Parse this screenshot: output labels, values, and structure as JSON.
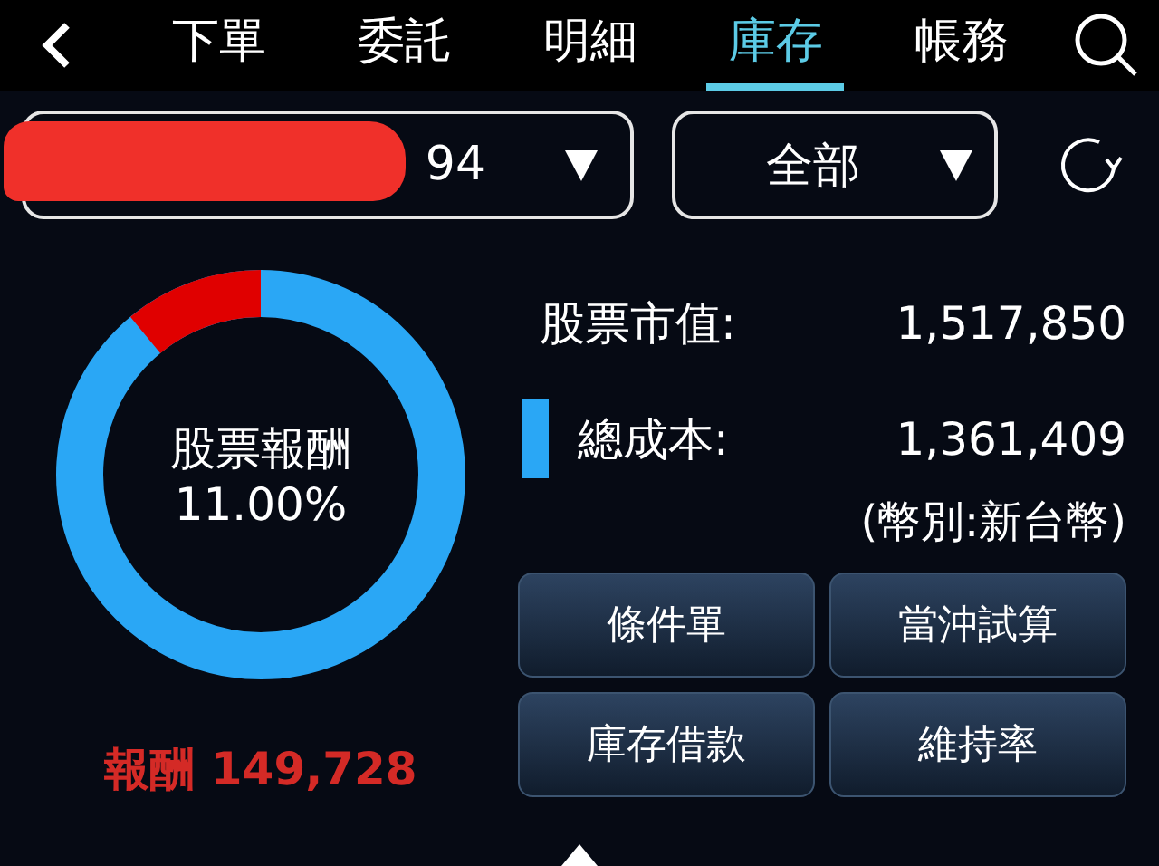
{
  "tabs": [
    {
      "label": "下單",
      "selected": false
    },
    {
      "label": "委託",
      "selected": false
    },
    {
      "label": "明細",
      "selected": false
    },
    {
      "label": "庫存",
      "selected": true
    },
    {
      "label": "帳務",
      "selected": false
    }
  ],
  "account": {
    "value": "94",
    "redacted": true
  },
  "filter": {
    "value": "全部"
  },
  "ring": {
    "title": "股票報酬",
    "percent": "11.00%"
  },
  "reward": {
    "label": "報酬",
    "value": "149,728"
  },
  "stats": [
    {
      "label": "股票市值:",
      "value": "1,517,850"
    },
    {
      "label": "總成本:",
      "value": "1,361,409",
      "color": "#2aa7f5"
    }
  ],
  "currency": "(幣別:新台幣)",
  "buttons": [
    "條件單",
    "當沖試算",
    "庫存借款",
    "維持率"
  ]
}
